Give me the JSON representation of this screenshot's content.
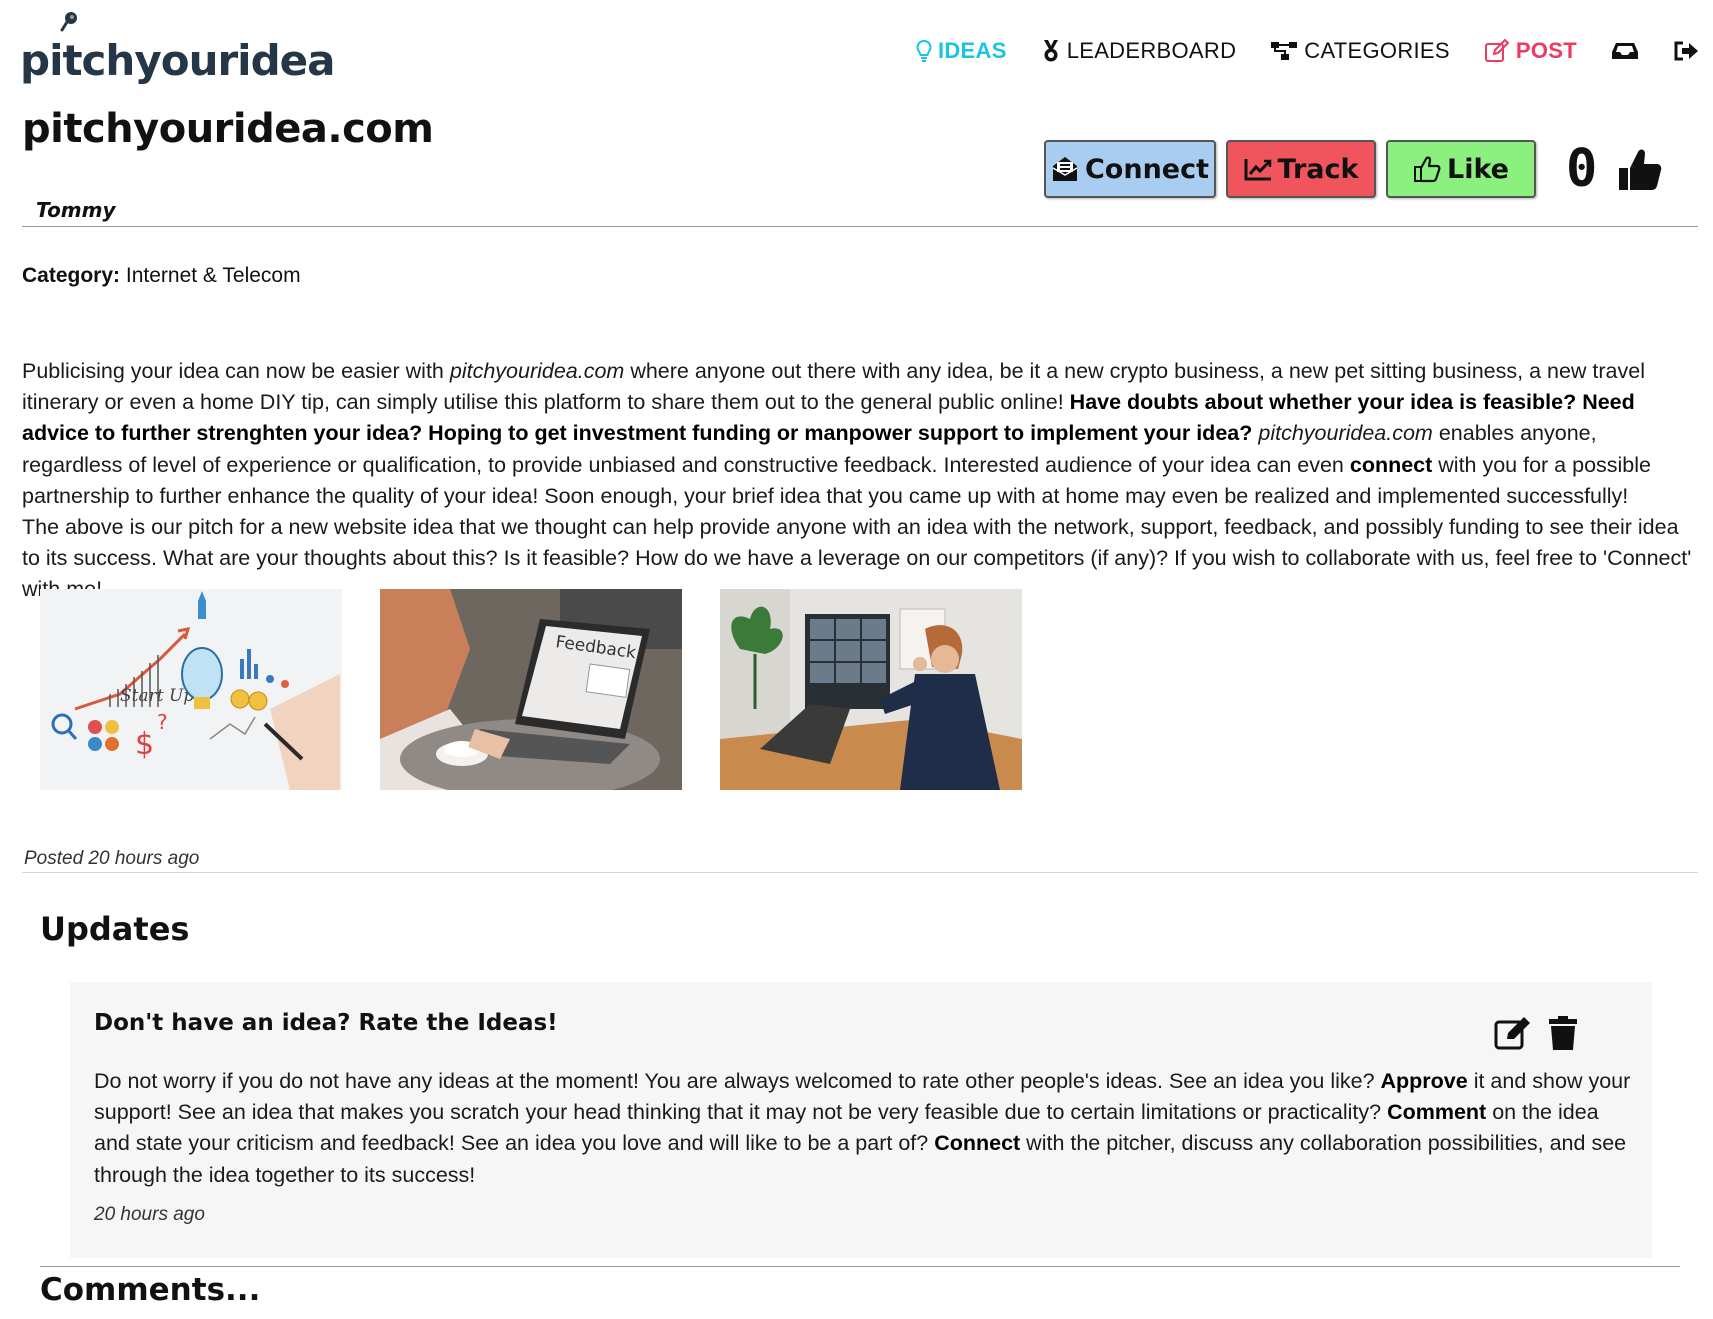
{
  "header": {
    "logo_text": "pitchyouridea",
    "nav": [
      {
        "label": "IDEAS",
        "icon": "lightbulb-icon"
      },
      {
        "label": "LEADERBOARD",
        "icon": "medal-icon"
      },
      {
        "label": "CATEGORIES",
        "icon": "sitemap-icon"
      },
      {
        "label": "POST",
        "icon": "edit-icon"
      },
      {
        "label": "",
        "icon": "inbox-icon"
      },
      {
        "label": "",
        "icon": "logout-icon"
      }
    ],
    "colors": {
      "ideas": "#1bc4e6",
      "post": "#ec3a63",
      "logo": "#253746"
    }
  },
  "idea": {
    "title": "pitchyouridea.com",
    "author": "Tommy",
    "category_label": "Category:",
    "category_value": "Internet & Telecom",
    "posted": "Posted 20 hours ago",
    "like_count": "0"
  },
  "actions": {
    "connect_label": "Connect",
    "track_label": "Track",
    "like_label": "Like",
    "colors": {
      "connect": "#a9cdf0",
      "track": "#f0545c",
      "like": "#8cf07f"
    }
  },
  "description": {
    "p1_a": "Publicising your idea can now be easier with ",
    "p1_site": "pitchyouridea.com",
    "p1_b": " where anyone out there with any idea, be it a new crypto business, a new pet sitting business, a new travel itinerary or even a home DIY tip, can simply utilise this platform to share them out to the general public online! ",
    "p1_bold": "Have doubts about whether your idea is feasible? Need advice to further strenghten your idea? Hoping to get investment funding or manpower support to implement your idea?",
    "p1_space": " ",
    "p1_site2": "pitchyouridea.com",
    "p1_c": " enables anyone, regardless of level of experience or qualification, to provide unbiased and constructive feedback. Interested audience of your idea can even ",
    "p1_connect": "connect",
    "p1_d": " with you for a possible partnership to further enhance the quality of your idea! Soon enough, your brief idea that you came up with at home may even be realized and implemented successfully!",
    "p2": "The above is our pitch for a new website idea that we thought can help provide anyone with an idea with the network, support, feedback, and possibly funding to see their idea to its success. What are your thoughts about this? Is it feasible? How do we have a leverage on our competitors (if any)? If you wish to collaborate with us, feel free to 'Connect' with me!"
  },
  "images": {
    "img1_word": "Start Up",
    "img2_word": "Feedback"
  },
  "updates": {
    "heading": "Updates",
    "item": {
      "title": "Don't have an idea? Rate the Ideas!",
      "body_a": "Do not worry if you do not have any ideas at the moment! You are always welcomed to rate other people's ideas. See an idea you like? ",
      "body_approve": "Approve",
      "body_b": " it and show your support! See an idea that makes you scratch your head thinking that it may not be very feasible due to certain limitations or practicality? ",
      "body_comment": "Comment",
      "body_c": " on the idea and state your criticism and feedback! See an idea you love and will like to be a part of? ",
      "body_connect": "Connect",
      "body_d": " with the pitcher, discuss any collaboration possibilities, and see through the idea together to its success!",
      "time": "20 hours ago"
    }
  },
  "comments": {
    "heading": "Comments..."
  }
}
